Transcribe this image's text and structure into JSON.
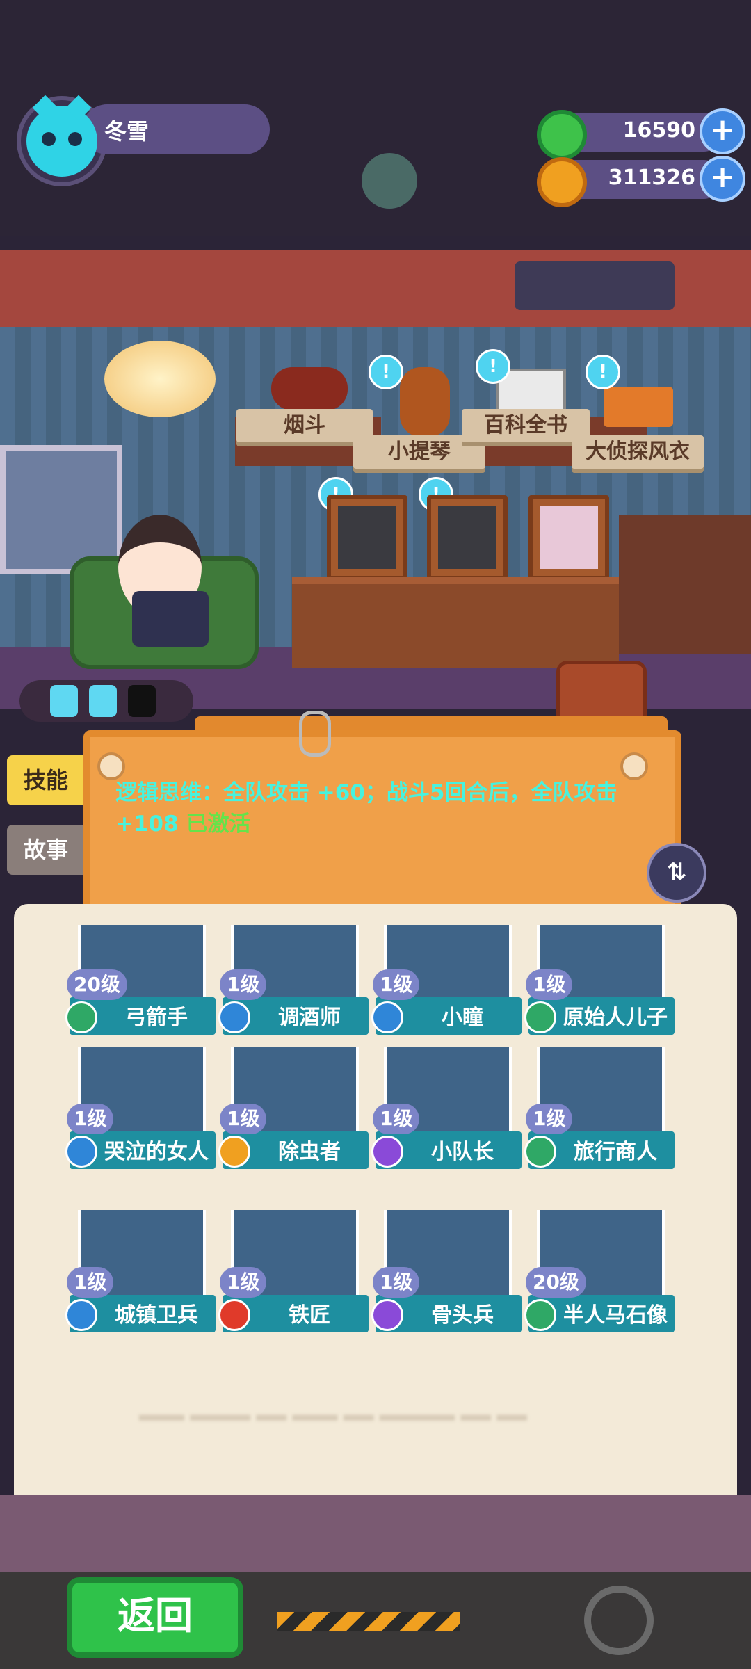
{
  "player": {
    "name": "冬雪"
  },
  "resources": [
    {
      "icon": "green-ring-coin-icon",
      "value": "16590",
      "color": "#3ec24a"
    },
    {
      "icon": "planet-coin-icon",
      "value": "311326",
      "color": "#f0a020"
    }
  ],
  "room_items": [
    {
      "label": "烟斗"
    },
    {
      "label": "小提琴"
    },
    {
      "label": "百科全书"
    },
    {
      "label": "大侦探风衣"
    }
  ],
  "energy": {
    "filled": 2,
    "total": 3
  },
  "side_tabs": [
    {
      "label": "技能"
    },
    {
      "label": "故事"
    }
  ],
  "skill": {
    "text": "逻辑思维：全队攻击 +60；战斗5回合后，全队攻击 +108",
    "status": "已激活"
  },
  "characters": [
    {
      "name": "弓箭手",
      "level": "20级",
      "badge_color": "#2fa866"
    },
    {
      "name": "调酒师",
      "level": "1级",
      "badge_color": "#2f86d8"
    },
    {
      "name": "小瞳",
      "level": "1级",
      "badge_color": "#2f86d8"
    },
    {
      "name": "原始人儿子",
      "level": "1级",
      "badge_color": "#2fa866"
    },
    {
      "name": "哭泣的女人",
      "level": "1级",
      "badge_color": "#2f86d8"
    },
    {
      "name": "除虫者",
      "level": "1级",
      "badge_color": "#f0a020"
    },
    {
      "name": "小队长",
      "level": "1级",
      "badge_color": "#8a4ad8"
    },
    {
      "name": "旅行商人",
      "level": "1级",
      "badge_color": "#2fa866"
    },
    {
      "name": "城镇卫兵",
      "level": "1级",
      "badge_color": "#2f86d8"
    },
    {
      "name": "铁匠",
      "level": "1级",
      "badge_color": "#e03a2a"
    },
    {
      "name": "骨头兵",
      "level": "1级",
      "badge_color": "#8a4ad8"
    },
    {
      "name": "半人马石像",
      "level": "20级",
      "badge_color": "#2fa866"
    }
  ],
  "footer": {
    "back_label": "返回"
  },
  "colors": {
    "accent": "#2fc24a",
    "board": "#f0a049",
    "skill_text": "#47f2df"
  }
}
